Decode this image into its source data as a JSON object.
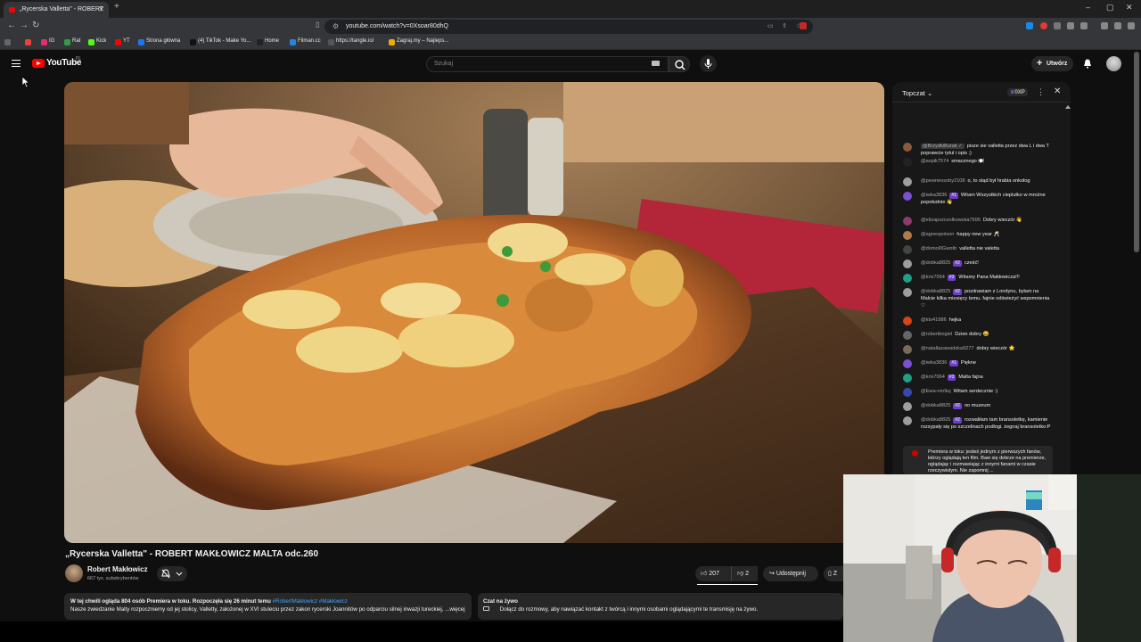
{
  "browser": {
    "tab_title": "„Rycerska Valletta\" - ROBERT",
    "url": "youtube.com/watch?v=0Xsoar80dhQ",
    "bookmarks": [
      {
        "label": "IG",
        "color": "#e1306c"
      },
      {
        "label": "Rat",
        "color": "#2f9e44"
      },
      {
        "label": "Kick",
        "color": "#53fc18"
      },
      {
        "label": "YT",
        "color": "#ff0000"
      },
      {
        "label": "Strona główna",
        "color": "#1877f2"
      },
      {
        "label": "(4) TikTok - Make Yo...",
        "color": "#111111"
      },
      {
        "label": "Home",
        "color": "#222222"
      },
      {
        "label": "Filman.cc",
        "color": "#1e88e5"
      },
      {
        "label": "https://tangle.io/",
        "color": "#555555"
      },
      {
        "label": "Zagraj.my – Najleps...",
        "color": "#f2a900"
      }
    ]
  },
  "masthead": {
    "logo": "YouTube",
    "country_code": "PL",
    "search_placeholder": "Szukaj",
    "create_label": "Utwórz"
  },
  "video": {
    "title": "„Rycerska Valletta\" - ROBERT MAKŁOWICZ MALTA odc.260",
    "channel_name": "Robert Makłowicz",
    "channel_subs": "667 tys. subskrybentów",
    "likes": "207",
    "dislikes": "2",
    "share_label": "Udostępnij",
    "save_label_partial": "Z",
    "description_lead": "W tej chwili ogląda 804 osób  Premiera w toku. Rozpoczęła się 26 minut temu",
    "description_tags": "#RobertMakłowicz #Makłowicz",
    "description_text": "Nasze zwiedzanie Malty rozpoczniemy od jej stolicy, Valletty, założonej w XVI stuleciu przez zakon rycerski Joannitów po odparciu silnej inwazji tureckiej, ...więcej"
  },
  "livechat_panel": {
    "title": "Czat na żywo",
    "text": "Dołącz do rozmowy, aby nawiązać kontakt z twórcą i innymi osobami oglądającymi te transmisję na żywo."
  },
  "chat": {
    "header": "Topczat",
    "xp_label": "0XP",
    "messages": [
      {
        "author": "@BrzydkiBurak ✓",
        "text": "pisze sie valletta przez dwa L i dwa T poprawcie tytul i opis ;)",
        "badge": "",
        "color": "#8a5a3a"
      },
      {
        "author": "@aspik7574",
        "text": "smacznego 🍽️",
        "badge": "",
        "color": "#222222"
      },
      {
        "author": "@pewneosoby2108",
        "text": "o, to stąd był hrabia onkolog",
        "badge": "",
        "color": "#9e9e9e"
      },
      {
        "author": "@iwka3836",
        "text": "Witam Wszystkich cieplutko w mroźne popołudnie 👋",
        "badge": "#1",
        "color": "#7b4fd6"
      },
      {
        "author": "@elizapszczolkowska7695",
        "text": "Dobry wieczór 👋",
        "badge": "",
        "color": "#8e3a6a"
      },
      {
        "author": "@agnespolson",
        "text": "happy new year 🥂",
        "badge": "",
        "color": "#b07b4a"
      },
      {
        "author": "@domol0Gwotb",
        "text": "valletta nie valetta",
        "badge": "",
        "color": "#444444"
      },
      {
        "author": "@dobka8825",
        "text": "cześć!",
        "badge": "#2",
        "color": "#9e9e9e"
      },
      {
        "author": "@kris7064",
        "text": "Witamy Pana Makłowicza!!!",
        "badge": "#3",
        "color": "#1fa085"
      },
      {
        "author": "@dobka8825",
        "text": "pozdrawiam z Londynu, byłam na Malcie kilka miesięcy temu. fajnie odświeżyć wspomnienia ♡",
        "badge": "#2",
        "color": "#9e9e9e"
      },
      {
        "author": "@kto41986",
        "text": "hejka",
        "badge": "",
        "color": "#d84315"
      },
      {
        "author": "@robertbogiel",
        "text": "Dzien dobry 😀",
        "badge": "",
        "color": "#666666"
      },
      {
        "author": "@natallazawadzka9277",
        "text": "dobry wieczór 🌟",
        "badge": "",
        "color": "#7a6a5a"
      },
      {
        "author": "@iwka3836",
        "text": "Piękne",
        "badge": "#1",
        "color": "#7b4fd6"
      },
      {
        "author": "@kris7064",
        "text": "Malta fajna",
        "badge": "#3",
        "color": "#1fa085"
      },
      {
        "author": "@Ewa-nm9uj",
        "text": "Witam serdecznie :)",
        "badge": "",
        "color": "#3949ab"
      },
      {
        "author": "@dobka8825",
        "text": "oo muzeum",
        "badge": "#2",
        "color": "#9e9e9e"
      },
      {
        "author": "@dobka8825",
        "text": "rozwaliłam tam bransoletkę, kamienie rozsypały się po szczelinach podłogi. żegnaj bransoletko:P",
        "badge": "#2",
        "color": "#9e9e9e"
      }
    ],
    "premiere_text": "Premiera w toku: jesteś jednym z pierwszych fanów, którzy oglądają ten film. Baw się dobrze na premierze, oglądając i rozmawiając z innymi fanami w czasie rzeczywistym. Nie zapomnij ..."
  }
}
